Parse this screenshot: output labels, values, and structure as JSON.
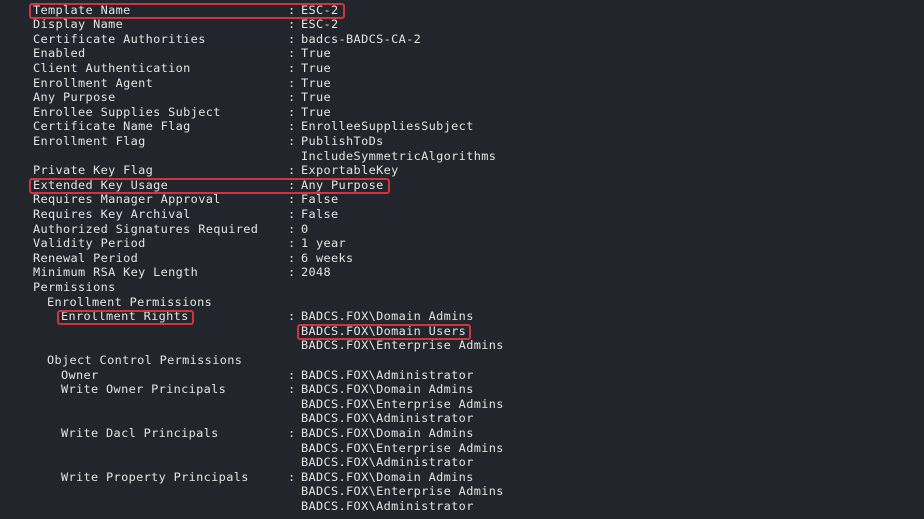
{
  "terminal": {
    "rows": [
      {
        "key": "Template Name",
        "indent": 0,
        "values": [
          "ESC-2"
        ]
      },
      {
        "key": "Display Name",
        "indent": 0,
        "values": [
          "ESC-2"
        ]
      },
      {
        "key": "Certificate Authorities",
        "indent": 0,
        "values": [
          "badcs-BADCS-CA-2"
        ]
      },
      {
        "key": "Enabled",
        "indent": 0,
        "values": [
          "True"
        ]
      },
      {
        "key": "Client Authentication",
        "indent": 0,
        "values": [
          "True"
        ]
      },
      {
        "key": "Enrollment Agent",
        "indent": 0,
        "values": [
          "True"
        ]
      },
      {
        "key": "Any Purpose",
        "indent": 0,
        "values": [
          "True"
        ]
      },
      {
        "key": "Enrollee Supplies Subject",
        "indent": 0,
        "values": [
          "True"
        ]
      },
      {
        "key": "Certificate Name Flag",
        "indent": 0,
        "values": [
          "EnrolleeSuppliesSubject"
        ]
      },
      {
        "key": "Enrollment Flag",
        "indent": 0,
        "values": [
          "PublishToDs",
          "IncludeSymmetricAlgorithms"
        ]
      },
      {
        "key": "Private Key Flag",
        "indent": 0,
        "values": [
          "ExportableKey"
        ]
      },
      {
        "key": "Extended Key Usage",
        "indent": 0,
        "values": [
          "Any Purpose"
        ]
      },
      {
        "key": "Requires Manager Approval",
        "indent": 0,
        "values": [
          "False"
        ]
      },
      {
        "key": "Requires Key Archival",
        "indent": 0,
        "values": [
          "False"
        ]
      },
      {
        "key": "Authorized Signatures Required",
        "indent": 0,
        "values": [
          "0"
        ]
      },
      {
        "key": "Validity Period",
        "indent": 0,
        "values": [
          "1 year"
        ]
      },
      {
        "key": "Renewal Period",
        "indent": 0,
        "values": [
          "6 weeks"
        ]
      },
      {
        "key": "Minimum RSA Key Length",
        "indent": 0,
        "values": [
          "2048"
        ]
      },
      {
        "key": "Permissions",
        "indent": 0,
        "values": []
      },
      {
        "key": "Enrollment Permissions",
        "indent": 1,
        "values": []
      },
      {
        "key": "Enrollment Rights",
        "indent": 2,
        "values": [
          "BADCS.FOX\\Domain Admins",
          "BADCS.FOX\\Domain Users",
          "BADCS.FOX\\Enterprise Admins"
        ]
      },
      {
        "key": "Object Control Permissions",
        "indent": 1,
        "values": []
      },
      {
        "key": "Owner",
        "indent": 2,
        "values": [
          "BADCS.FOX\\Administrator"
        ]
      },
      {
        "key": "Write Owner Principals",
        "indent": 2,
        "values": [
          "BADCS.FOX\\Domain Admins",
          "BADCS.FOX\\Enterprise Admins",
          "BADCS.FOX\\Administrator"
        ]
      },
      {
        "key": "Write Dacl Principals",
        "indent": 2,
        "values": [
          "BADCS.FOX\\Domain Admins",
          "BADCS.FOX\\Enterprise Admins",
          "BADCS.FOX\\Administrator"
        ]
      },
      {
        "key": "Write Property Principals",
        "indent": 2,
        "values": [
          "BADCS.FOX\\Domain Admins",
          "BADCS.FOX\\Enterprise Admins",
          "BADCS.FOX\\Administrator"
        ]
      }
    ],
    "separator": ":",
    "highlights": [
      {
        "target": "Template Name",
        "scope": "row"
      },
      {
        "target": "Extended Key Usage",
        "scope": "row"
      },
      {
        "target": "Enrollment Rights",
        "scope": "key"
      },
      {
        "target": "BADCS.FOX\\Domain Users",
        "scope": "value"
      }
    ],
    "highlight_color": "#d0353b",
    "background_color": "#22252b",
    "text_color": "#e4e4e4"
  }
}
